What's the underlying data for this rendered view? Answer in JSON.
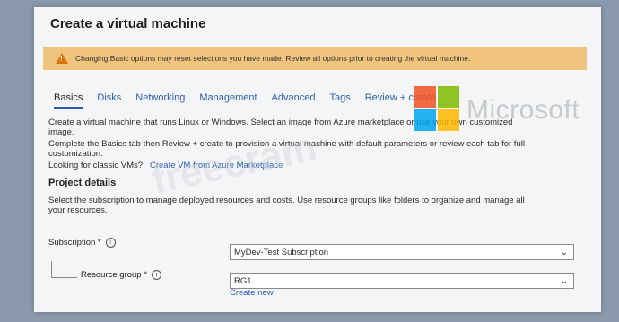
{
  "page": {
    "title": "Create a virtual machine",
    "warning": "Changing Basic options may reset selections you have made. Review all options prior to creating the virtual machine."
  },
  "tabs": [
    {
      "label": "Basics"
    },
    {
      "label": "Disks"
    },
    {
      "label": "Networking"
    },
    {
      "label": "Management"
    },
    {
      "label": "Advanced"
    },
    {
      "label": "Tags"
    },
    {
      "label": "Review + create"
    }
  ],
  "intro": {
    "line1": "Create a virtual machine that runs Linux or Windows. Select an image from Azure marketplace or use your own customized",
    "line1b": "image.",
    "line2": "Complete the Basics tab then Review + create to provision a virtual machine with default parameters or review each tab for full",
    "line2b": "customization.",
    "classic_label": "Looking for classic VMs?",
    "classic_link": "Create VM from Azure Marketplace"
  },
  "project": {
    "heading": "Project details",
    "desc1": "Select the subscription to manage deployed resources and costs. Use resource groups like folders to organize and manage all",
    "desc2": "your resources.",
    "subscription_label": "Subscription *",
    "subscription_value": "MyDev-Test Subscription",
    "rg_label": "Resource group *",
    "rg_value": "RG1",
    "create_new": "Create new"
  },
  "watermarks": {
    "brand": "Microsoft",
    "site": "freecram"
  },
  "colors": {
    "accent": "#2a5db0",
    "warning_bg": "#f0c47c",
    "ms_red": "#f25022",
    "ms_green": "#7fba00",
    "ms_blue": "#00a4ef",
    "ms_yellow": "#ffb900"
  }
}
